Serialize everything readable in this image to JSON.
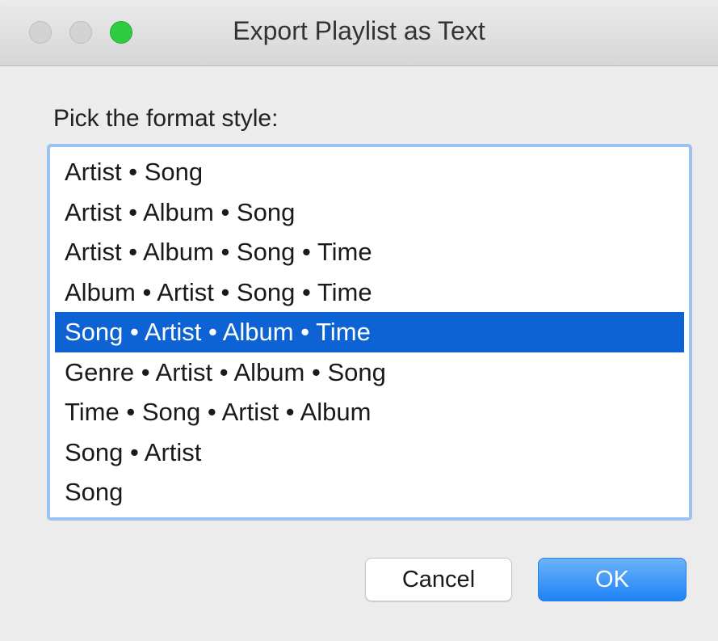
{
  "window": {
    "title": "Export Playlist as Text"
  },
  "dialog": {
    "prompt": "Pick the format style:",
    "selected_index": 4,
    "options": [
      "Artist • Song",
      "Artist • Album • Song",
      "Artist • Album • Song • Time",
      "Album • Artist • Song • Time",
      "Song • Artist • Album • Time",
      "Genre • Artist • Album • Song",
      "Time • Song • Artist • Album",
      "Song • Artist",
      "Song"
    ],
    "cancel_label": "Cancel",
    "ok_label": "OK"
  },
  "colors": {
    "selection": "#0d63d3",
    "focus_ring": "#9cc3ef",
    "ok_button": "#1e82f7",
    "zoom_button": "#2ecc40"
  }
}
